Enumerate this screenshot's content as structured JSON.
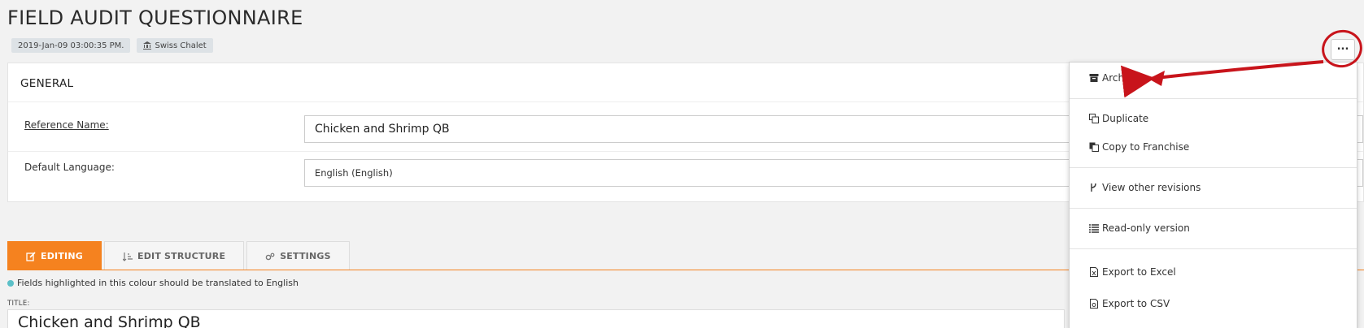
{
  "header": {
    "title": "FIELD AUDIT QUESTIONNAIRE",
    "timestamp": "2019-Jan-09 03:00:35 PM.",
    "brand": "Swiss Chalet",
    "more_label": "..."
  },
  "general": {
    "heading": "GENERAL",
    "reference_label": "Reference Name:",
    "reference_value": "Chicken and Shrimp QB",
    "language_label": "Default Language:",
    "language_value": "English (English)"
  },
  "tabs": [
    {
      "label": "EDITING",
      "icon": "edit-icon",
      "active": true
    },
    {
      "label": "EDIT STRUCTURE",
      "icon": "sort-icon",
      "active": false
    },
    {
      "label": "SETTINGS",
      "icon": "gears-icon",
      "active": false
    }
  ],
  "hint": "Fields highlighted in this colour should be translated to English",
  "title_field": {
    "label": "TITLE:",
    "value": "Chicken and Shrimp QB"
  },
  "menu": {
    "items": [
      {
        "label": "Archive",
        "icon": "archive-icon"
      },
      {
        "label": "Duplicate",
        "icon": "duplicate-icon"
      },
      {
        "label": "Copy to Franchise",
        "icon": "copy-icon"
      },
      {
        "label": "View other revisions",
        "icon": "branch-icon"
      },
      {
        "label": "Read-only version",
        "icon": "list-icon"
      },
      {
        "label": "Export to Excel",
        "icon": "excel-file-icon"
      },
      {
        "label": "Export to CSV",
        "icon": "csv-file-icon"
      }
    ]
  },
  "colors": {
    "accent": "#f5821f",
    "annotation": "#c8141b",
    "hint_dot": "#5bc0c8"
  }
}
